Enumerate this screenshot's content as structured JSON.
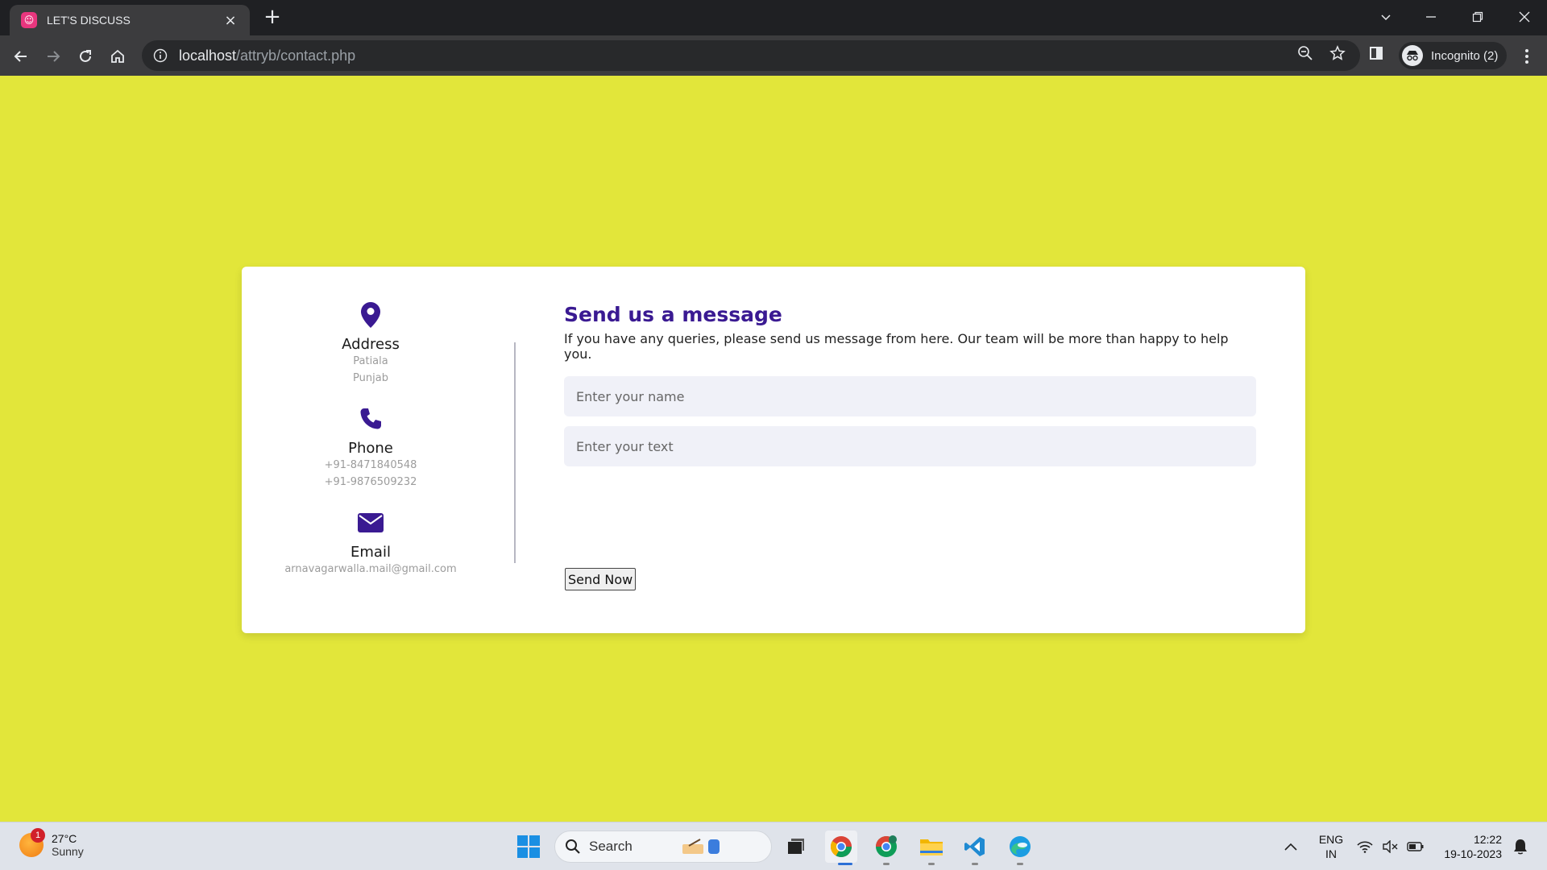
{
  "browser": {
    "tab_title": "LET'S DISCUSS",
    "tab_close": "×",
    "new_tab": "+",
    "url_host": "localhost",
    "url_path": "/attryb/contact.php",
    "profile_label": "Incognito (2)"
  },
  "contact_info": {
    "address": {
      "title": "Address",
      "lines": [
        "Patiala",
        "Punjab"
      ]
    },
    "phone": {
      "title": "Phone",
      "lines": [
        "+91-8471840548",
        "+91-9876509232"
      ]
    },
    "email": {
      "title": "Email",
      "lines": [
        "arnavagarwalla.mail@gmail.com"
      ]
    }
  },
  "form": {
    "title": "Send us a message",
    "subtitle": "If you have any queries, please send us message from here. Our team will be more than happy to help you.",
    "name_placeholder": "Enter your name",
    "text_placeholder": "Enter your text",
    "submit_label": "Send Now"
  },
  "taskbar": {
    "weather_temp": "27°C",
    "weather_desc": "Sunny",
    "weather_badge": "1",
    "search_label": "Search",
    "lang_line1": "ENG",
    "lang_line2": "IN",
    "time": "12:22",
    "date": "19-10-2023"
  },
  "colors": {
    "page_background": "#e2e63a",
    "accent": "#3a1a92",
    "field_background": "#f0f1f8"
  }
}
